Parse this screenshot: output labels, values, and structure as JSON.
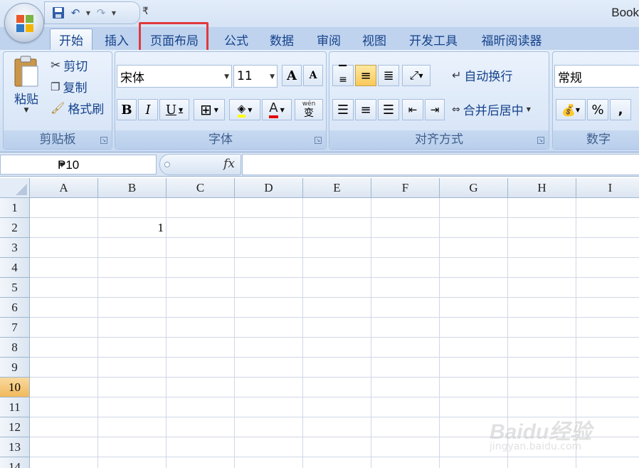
{
  "window": {
    "title": "Book"
  },
  "qat": {
    "customize_symbol": "₹"
  },
  "tabs": [
    {
      "label": "开始",
      "active": true
    },
    {
      "label": "插入"
    },
    {
      "label": "页面布局",
      "highlighted": true
    },
    {
      "label": "公式"
    },
    {
      "label": "数据"
    },
    {
      "label": "审阅"
    },
    {
      "label": "视图"
    },
    {
      "label": "开发工具"
    },
    {
      "label": "福昕阅读器"
    }
  ],
  "clipboard": {
    "group_label": "剪贴板",
    "paste": "粘贴",
    "cut": "剪切",
    "copy": "复制",
    "format_painter": "格式刷"
  },
  "font": {
    "group_label": "字体",
    "family": "宋体",
    "size": "11",
    "grow": "A",
    "shrink": "A",
    "bold": "B",
    "italic": "I",
    "underline": "U",
    "font_color_letter": "A",
    "phonetic": "wén",
    "phonetic_char": "变"
  },
  "alignment": {
    "group_label": "对齐方式",
    "wrap_text": "自动换行",
    "merge_center": "合并后居中"
  },
  "number": {
    "group_label": "数字",
    "format": "常规",
    "percent": "%",
    "comma": ","
  },
  "formula_bar": {
    "name_box": "P10",
    "fx": "fx",
    "value": ""
  },
  "sheet": {
    "columns": [
      "A",
      "B",
      "C",
      "D",
      "E",
      "F",
      "G",
      "H",
      "I"
    ],
    "rows": [
      "1",
      "2",
      "3",
      "4",
      "5",
      "6",
      "7",
      "8",
      "9",
      "10",
      "11",
      "12",
      "13",
      "14"
    ],
    "selected_row": "10",
    "cells": {
      "B2": "1"
    }
  },
  "watermark": {
    "line1": "Baidu经验",
    "line2": "jingyan.baidu.com"
  },
  "colors": {
    "accent": "#15428b",
    "highlight_box": "#e0393d",
    "selected_header": "#f1b95b"
  }
}
